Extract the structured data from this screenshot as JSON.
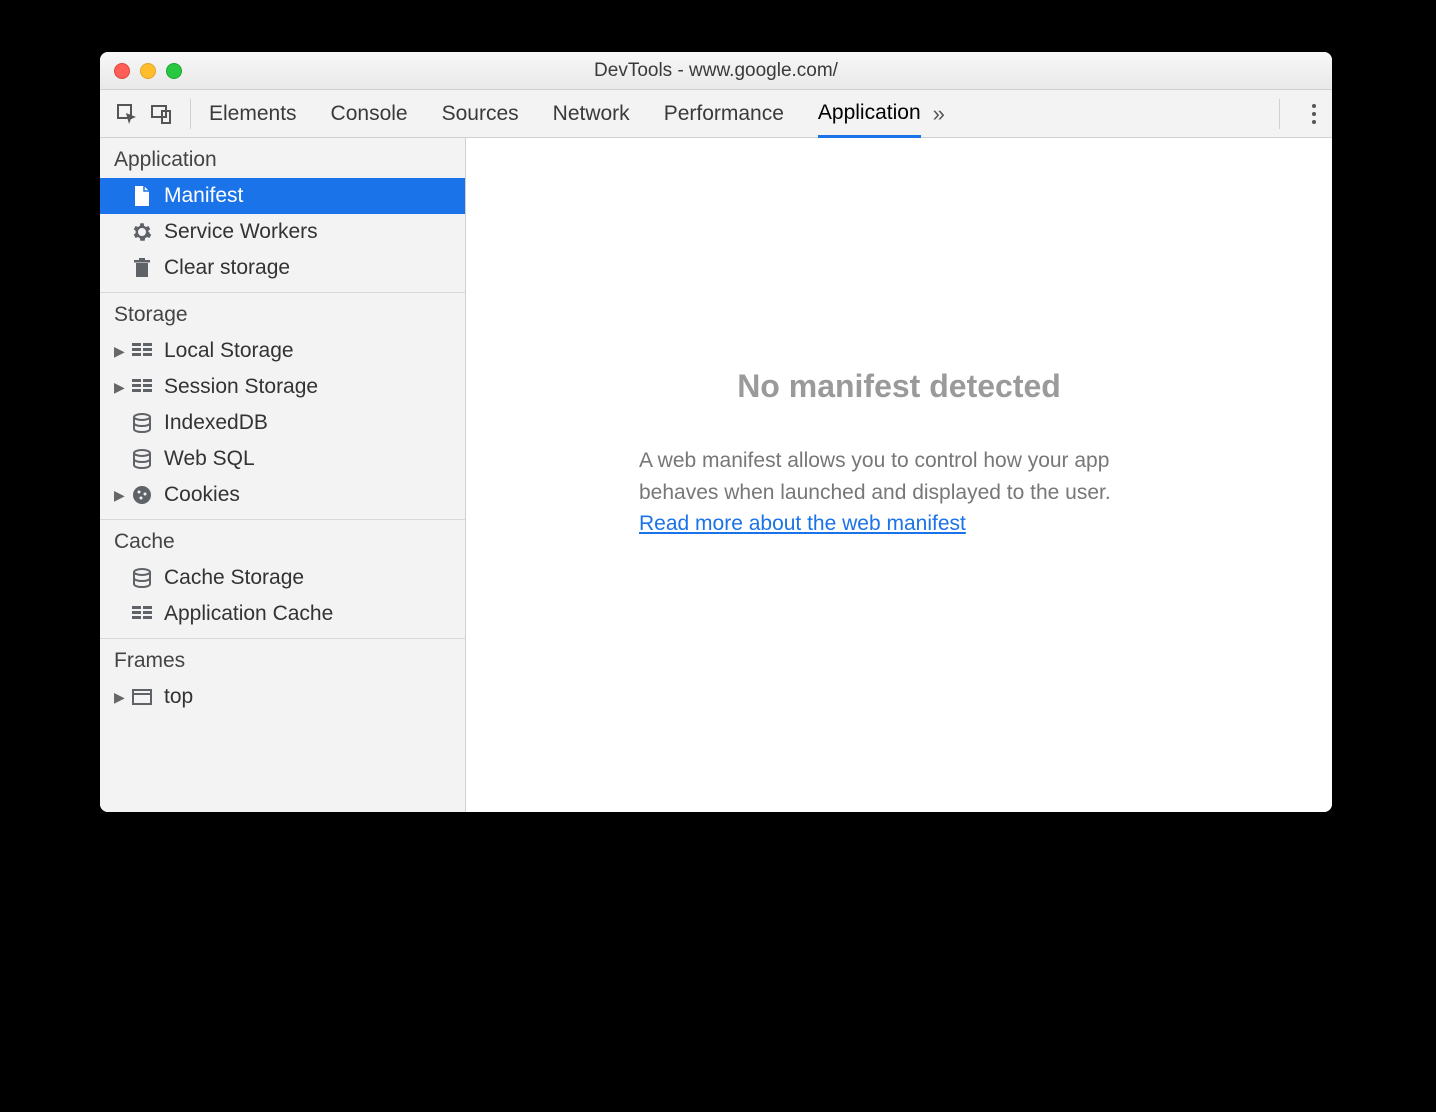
{
  "window": {
    "title": "DevTools - www.google.com/"
  },
  "toolbar": {
    "tabs": [
      "Elements",
      "Console",
      "Sources",
      "Network",
      "Performance",
      "Application"
    ],
    "active_tab_index": 5
  },
  "sidebar": {
    "sections": [
      {
        "title": "Application",
        "items": [
          {
            "label": "Manifest",
            "icon": "file",
            "expandable": false,
            "selected": true
          },
          {
            "label": "Service Workers",
            "icon": "gear",
            "expandable": false,
            "selected": false
          },
          {
            "label": "Clear storage",
            "icon": "trash",
            "expandable": false,
            "selected": false
          }
        ]
      },
      {
        "title": "Storage",
        "items": [
          {
            "label": "Local Storage",
            "icon": "grid",
            "expandable": true,
            "selected": false
          },
          {
            "label": "Session Storage",
            "icon": "grid",
            "expandable": true,
            "selected": false
          },
          {
            "label": "IndexedDB",
            "icon": "db",
            "expandable": false,
            "selected": false
          },
          {
            "label": "Web SQL",
            "icon": "db",
            "expandable": false,
            "selected": false
          },
          {
            "label": "Cookies",
            "icon": "cookie",
            "expandable": true,
            "selected": false
          }
        ]
      },
      {
        "title": "Cache",
        "items": [
          {
            "label": "Cache Storage",
            "icon": "db",
            "expandable": false,
            "selected": false
          },
          {
            "label": "Application Cache",
            "icon": "grid",
            "expandable": false,
            "selected": false
          }
        ]
      },
      {
        "title": "Frames",
        "items": [
          {
            "label": "top",
            "icon": "frame",
            "expandable": true,
            "selected": false
          }
        ]
      }
    ]
  },
  "main": {
    "heading": "No manifest detected",
    "body": "A web manifest allows you to control how your app behaves when launched and displayed to the user.",
    "link_text": "Read more about the web manifest"
  }
}
